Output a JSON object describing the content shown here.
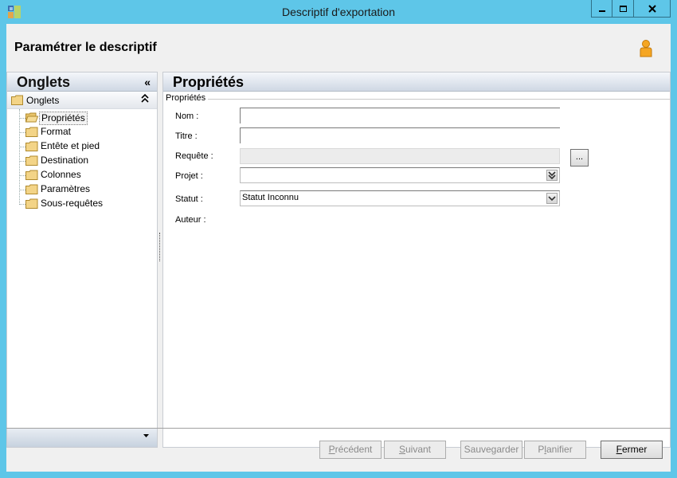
{
  "window": {
    "title": "Descriptif d'exportation"
  },
  "header": {
    "title": "Paramétrer le descriptif",
    "user_icon": "user-icon"
  },
  "left_panel": {
    "title": "Onglets",
    "collapse_symbol": "«",
    "group": {
      "label": "Onglets",
      "toggle_symbol": "⌃"
    },
    "items": [
      {
        "label": "Propriétés",
        "selected": true
      },
      {
        "label": "Format"
      },
      {
        "label": "Entête et pied"
      },
      {
        "label": "Destination"
      },
      {
        "label": "Colonnes"
      },
      {
        "label": "Paramètres"
      },
      {
        "label": "Sous-requêtes"
      }
    ]
  },
  "right_panel": {
    "title": "Propriétés",
    "group_title": "Propriétés",
    "fields": {
      "nom": {
        "label": "Nom :",
        "value": ""
      },
      "titre": {
        "label": "Titre :",
        "value": ""
      },
      "requete": {
        "label": "Requête :",
        "value": "",
        "browse_label": "..."
      },
      "projet": {
        "label": "Projet :",
        "value": ""
      },
      "statut": {
        "label": "Statut :",
        "value": "Statut Inconnu"
      },
      "auteur": {
        "label": "Auteur :"
      }
    }
  },
  "footer": {
    "buttons": {
      "precedent": {
        "mnemonic": "P",
        "rest": "récédent",
        "enabled": false
      },
      "suivant": {
        "mnemonic": "S",
        "rest": "uivant",
        "enabled": false
      },
      "sauvegarder": {
        "label": "Sauvegarder",
        "enabled": false
      },
      "planifier_pre": "P",
      "planifier_mn": "l",
      "planifier_rest": "anifier",
      "fermer": {
        "mnemonic": "F",
        "rest": "ermer",
        "enabled": true
      }
    }
  },
  "colors": {
    "title_bar": "#5ec6e8",
    "client_bg": "#f0f0f0",
    "panel_header_gradient_end": "#cfd8e4"
  }
}
